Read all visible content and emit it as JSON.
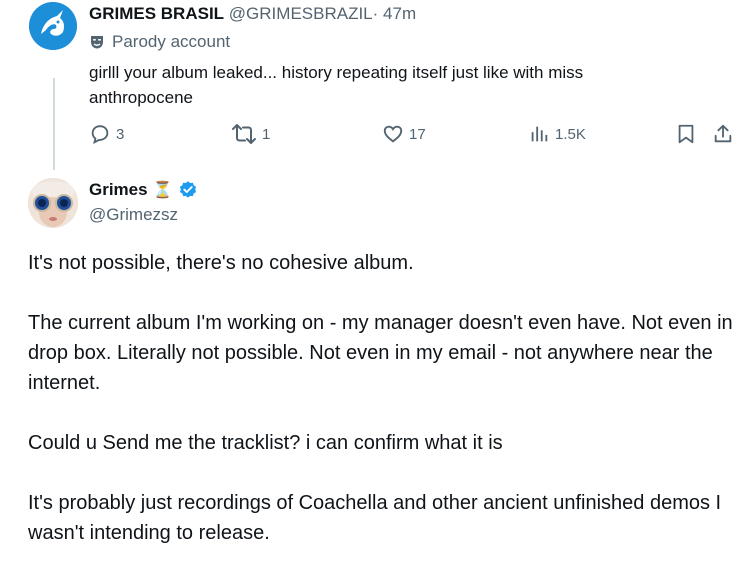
{
  "parent_tweet": {
    "display_name": "GRIMES BRASIL",
    "handle": "@GRIMESBRAZIL",
    "separator": "·",
    "time": "47m",
    "badge_label": "Parody account",
    "text": "girlll your album leaked... history repeating itself just like with miss anthropocene",
    "stats": {
      "replies": "3",
      "reposts": "1",
      "likes": "17",
      "views": "1.5K"
    }
  },
  "reply_tweet": {
    "display_name": "Grimes",
    "name_emoji": "⏳",
    "handle": "@Grimezsz",
    "paragraphs": [
      "It's not possible, there's no cohesive album.",
      "The current album I'm working on - my manager doesn't even have. Not even in drop box.  Literally not possible.  Not even in my email - not anywhere near the internet.",
      "Could u Send me the tracklist? i can confirm what it is",
      "It's probably just recordings of Coachella and other ancient unfinished demos I wasn't intending to release."
    ]
  },
  "colors": {
    "text": "#0f1419",
    "muted": "#536471",
    "verified": "#1d9bf0",
    "thread_line": "#cfd9de"
  }
}
